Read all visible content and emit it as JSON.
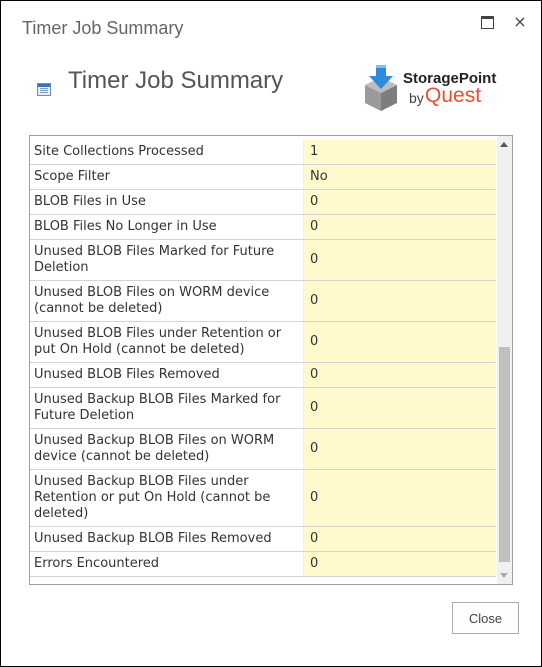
{
  "dialog": {
    "title": "Timer Job Summary",
    "maximize_icon": "maximize-icon",
    "close_icon": "×"
  },
  "header": {
    "icon": "table-list-icon",
    "title": "Timer Job Summary",
    "logo": {
      "line1": "StoragePoint",
      "by": "by",
      "brand": "Quest",
      "colors": {
        "arrow": "#2e8ce0",
        "box": "#8a8a8a",
        "brand": "#e8502e"
      }
    }
  },
  "summary": {
    "rows": [
      {
        "label": "Site Collections Processed",
        "value": "1"
      },
      {
        "label": "Scope Filter",
        "value": "No"
      },
      {
        "label": "BLOB Files in Use",
        "value": "0"
      },
      {
        "label": "BLOB Files No Longer in Use",
        "value": "0"
      },
      {
        "label": "Unused BLOB Files Marked for Future Deletion",
        "value": "0"
      },
      {
        "label": "Unused BLOB Files on WORM device (cannot be deleted)",
        "value": "0"
      },
      {
        "label": "Unused BLOB Files under Retention or put On Hold (cannot be deleted)",
        "value": "0"
      },
      {
        "label": "Unused BLOB Files Removed",
        "value": "0"
      },
      {
        "label": "Unused Backup BLOB Files Marked for Future Deletion",
        "value": "0"
      },
      {
        "label": "Unused Backup BLOB Files on WORM device (cannot be deleted)",
        "value": "0"
      },
      {
        "label": "Unused Backup BLOB Files under Retention or put On Hold (cannot be deleted)",
        "value": "0"
      },
      {
        "label": "Unused Backup BLOB Files Removed",
        "value": "0"
      },
      {
        "label": "Errors Encountered",
        "value": "0"
      }
    ],
    "value_bg": "#fff9cd",
    "scroll": {
      "thumb_start": 0.47,
      "thumb_end": 0.98
    }
  },
  "footer": {
    "close_label": "Close"
  }
}
